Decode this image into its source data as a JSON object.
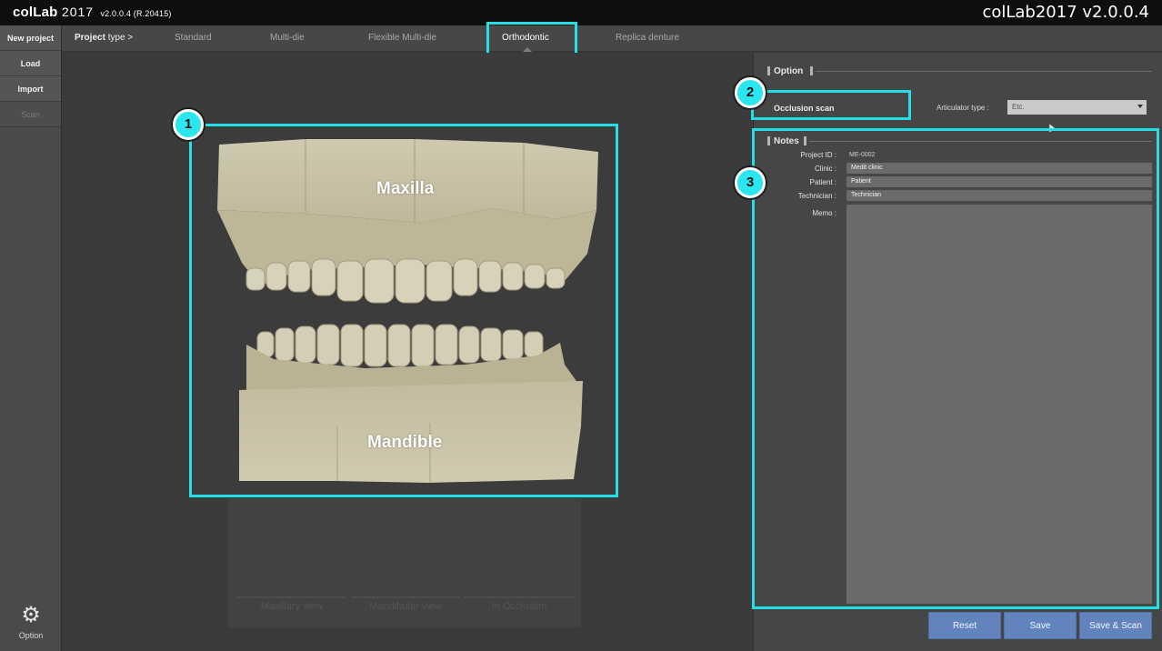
{
  "app": {
    "logo_name": "colLab",
    "logo_year": "2017",
    "logo_version": "v2.0.0.4 (R.20415)",
    "title_right": "colLab2017 v2.0.0.4"
  },
  "sidebar": {
    "items": [
      {
        "label": "New project",
        "enabled": true
      },
      {
        "label": "Load",
        "enabled": true
      },
      {
        "label": "Import",
        "enabled": true
      },
      {
        "label": "Scan",
        "enabled": false
      }
    ],
    "option_label": "Option",
    "option_icon": "gear-icon"
  },
  "project_type": {
    "lead_label": "Project",
    "lead_suffix": "type >",
    "tabs": [
      {
        "label": "Standard"
      },
      {
        "label": "Multi-die"
      },
      {
        "label": "Flexible Multi-die"
      },
      {
        "label": "Orthodontic",
        "selected": true
      },
      {
        "label": "Replica denture"
      }
    ]
  },
  "model_preview": {
    "upper_label": "Maxilla",
    "lower_label": "Mandible",
    "views": [
      "Maxillary view",
      "Mandibular view",
      "In Occlusion"
    ]
  },
  "callouts": [
    "1",
    "2",
    "3"
  ],
  "option": {
    "header": "Option",
    "occlusion_scan_label": "Occlusion scan",
    "articulator_label": "Articulator type :",
    "articulator_value": "Etc."
  },
  "notes": {
    "header": "Notes",
    "project_id_label": "Project ID :",
    "project_id_value": "ME-0002",
    "clinic_label": "Clinic :",
    "clinic_value": "Medit clinic",
    "patient_label": "Patient :",
    "patient_value": "Patient",
    "technician_label": "Technician :",
    "technician_value": "Technician",
    "memo_label": "Memo :",
    "memo_value": ""
  },
  "actions": {
    "reset": "Reset",
    "save": "Save",
    "save_scan": "Save & Scan"
  },
  "colors": {
    "highlight": "#24e0e6",
    "button": "#6383bf",
    "model": "#cbc5ac"
  }
}
